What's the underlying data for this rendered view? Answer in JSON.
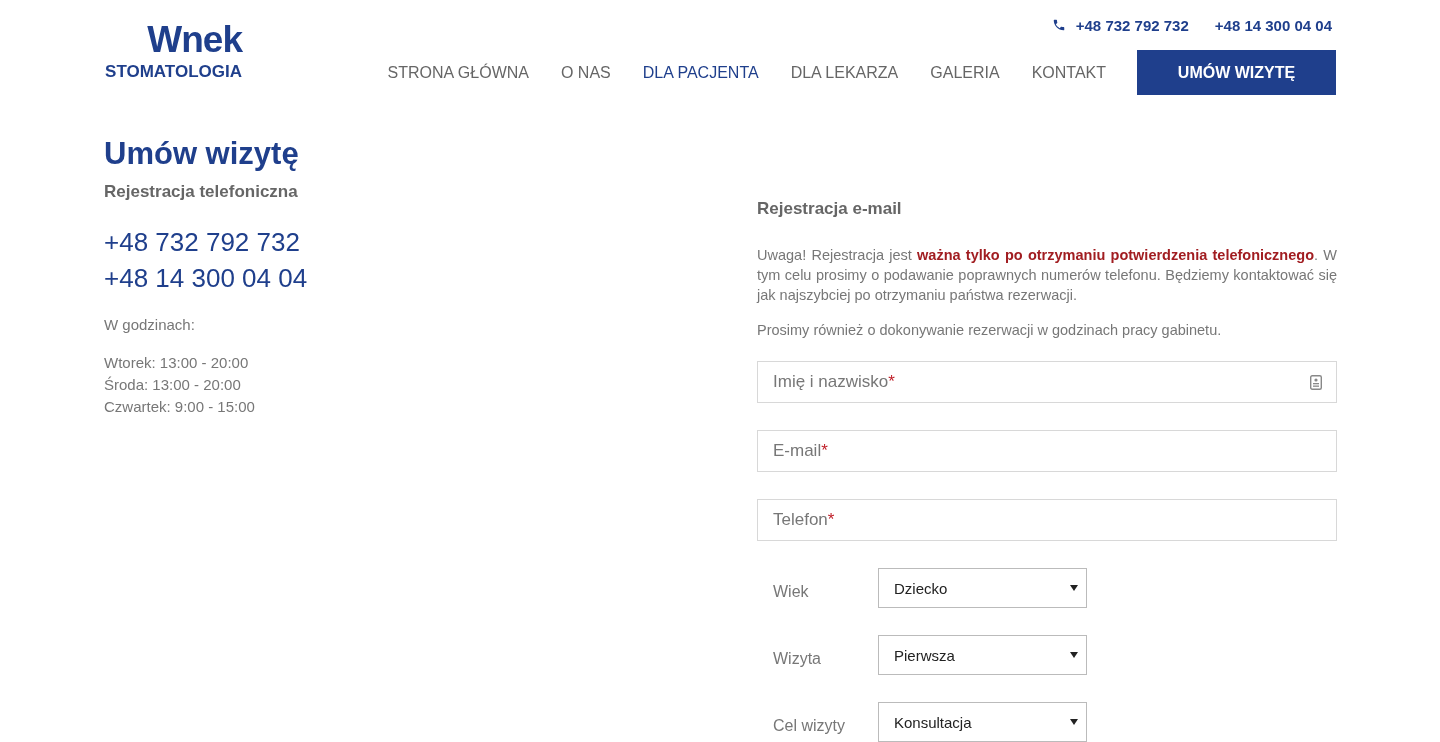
{
  "logo": {
    "name": "Wnek",
    "subtitle": "STOMATOLOGIA"
  },
  "header_phones": [
    "+48 732 792 732",
    "+48 14 300 04 04"
  ],
  "nav": [
    {
      "label": "STRONA GŁÓWNA",
      "selected": false
    },
    {
      "label": "O NAS",
      "selected": false
    },
    {
      "label": "DLA PACJENTA",
      "selected": true
    },
    {
      "label": "DLA LEKARZA",
      "selected": false
    },
    {
      "label": "GALERIA",
      "selected": false
    },
    {
      "label": "KONTAKT",
      "selected": false
    }
  ],
  "cta_button": "UMÓW WIZYTĘ",
  "page_title": "Umów wizytę",
  "phone_registration": {
    "heading": "Rejestracja telefoniczna",
    "phones": [
      "+48 732 792 732",
      "+48 14 300 04 04"
    ],
    "hours_label": "W godzinach:",
    "hours": [
      "Wtorek: 13:00 - 20:00",
      "Środa: 13:00 - 20:00",
      "Czwartek: 9:00 - 15:00"
    ]
  },
  "email_registration": {
    "heading": "Rejestracja e-mail",
    "paragraphs": [
      "Uwaga! Rejestracja jest **ważna tylko po otrzymaniu potwierdzenia telefonicznego**. W tym celu prosimy o podawanie poprawnych numerów telefonu. Będziemy kontaktować się jak najszybciej po otrzymaniu państwa rezerwacji.",
      "Prosimy również o dokonywanie rezerwacji w godzinach pracy gabinetu."
    ],
    "fields": [
      {
        "placeholder": "Imię i nazwisko",
        "mark": "*",
        "has_icon": true
      },
      {
        "placeholder": "E-mail",
        "mark": "*",
        "has_icon": false
      },
      {
        "placeholder": "Telefon",
        "mark": "*",
        "has_icon": false
      }
    ],
    "selects": [
      {
        "label": "Wiek",
        "value": "Dziecko"
      },
      {
        "label": "Wizyta",
        "value": "Pierwsza"
      },
      {
        "label": "Cel wizyty",
        "value": "Konsultacja"
      }
    ]
  }
}
